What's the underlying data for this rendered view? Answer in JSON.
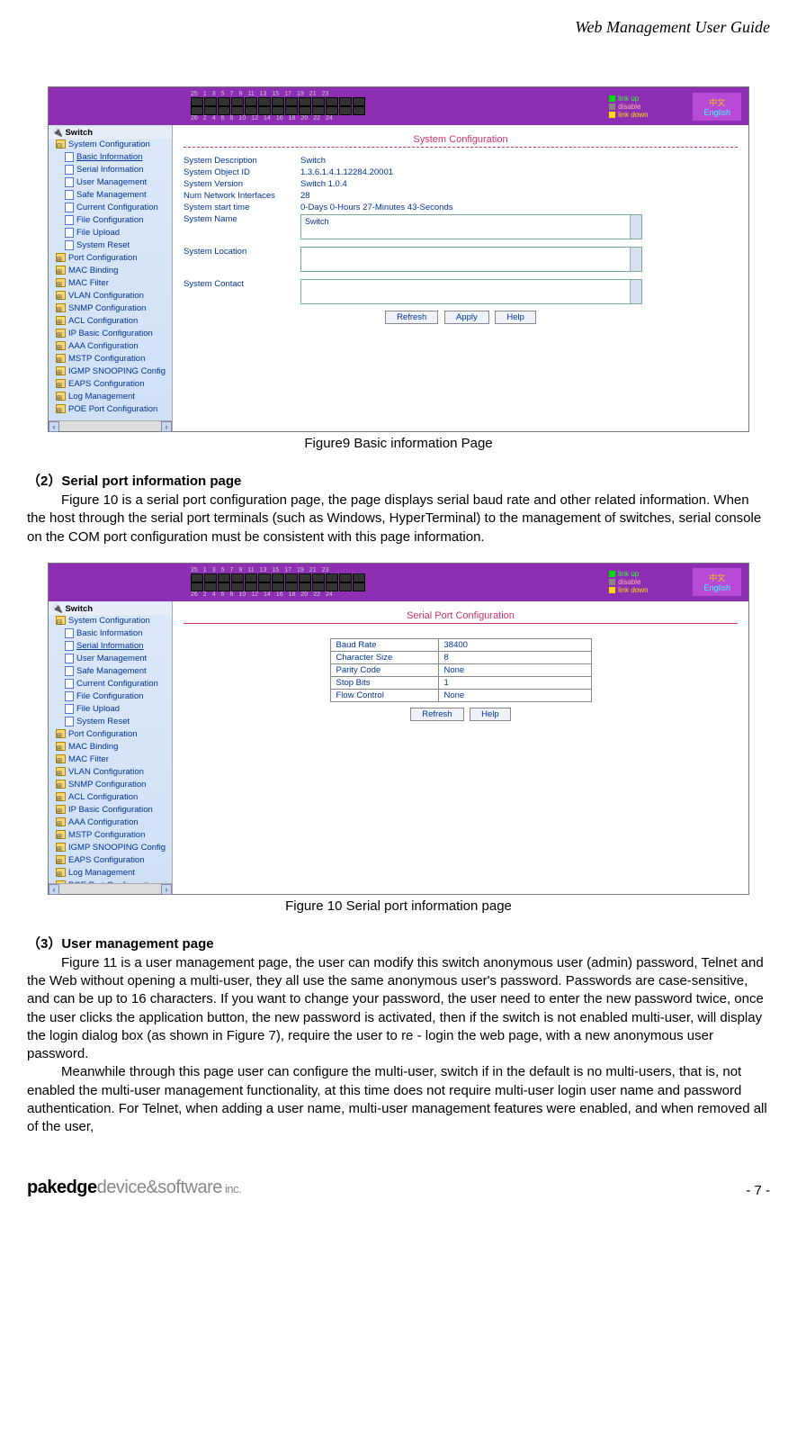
{
  "doc_header": "Web Management User Guide",
  "figure9": {
    "caption": "Figure9 Basic information Page",
    "legend": {
      "up": "link up",
      "disable": "disable",
      "down": "link down"
    },
    "lang": {
      "cn": "中文",
      "en": "English"
    },
    "side_title": "Switch",
    "sidebar_sys": "System Configuration",
    "sidebar_items": [
      "Basic Information",
      "Serial Information",
      "User Management",
      "Safe Management",
      "Current Configuration",
      "File Configuration",
      "File Upload",
      "System Reset"
    ],
    "sidebar_folders": [
      "Port Configuration",
      "MAC Binding",
      "MAC Filter",
      "VLAN Configuration",
      "SNMP Configuration",
      "ACL Configuration",
      "IP Basic Configuration",
      "AAA Configuration",
      "MSTP Configuration",
      "IGMP SNOOPING Config",
      "EAPS Configuration",
      "Log Management",
      "POE Port Configuration"
    ],
    "main_title": "System Configuration",
    "rows": {
      "desc_l": "System Description",
      "desc_v": "Switch",
      "oid_l": "System Object ID",
      "oid_v": "1.3.6.1.4.1.12284.20001",
      "ver_l": "System Version",
      "ver_v": "Switch 1.0.4",
      "num_l": "Num Network Interfaces",
      "num_v": "28",
      "start_l": "System start time",
      "start_v": "0-Days 0-Hours 27-Minutes 43-Seconds",
      "name_l": "System Name",
      "name_v": "Switch",
      "loc_l": "System Location",
      "con_l": "System Contact"
    },
    "buttons": {
      "refresh": "Refresh",
      "apply": "Apply",
      "help": "Help"
    }
  },
  "section2": {
    "heading": "（2）Serial port information page",
    "body": "Figure 10 is a serial port configuration page, the page displays serial baud rate and other related information. When the host through the serial port terminals (such as Windows, HyperTerminal) to the management of switches, serial console on the COM port configuration must be consistent with this page information."
  },
  "figure10": {
    "caption": "Figure 10 Serial port information page",
    "main_title": "Serial Port Configuration",
    "table": {
      "baud_l": "Baud Rate",
      "baud_v": "38400",
      "char_l": "Character Size",
      "char_v": "8",
      "par_l": "Parity Code",
      "par_v": "None",
      "stop_l": "Stop Bits",
      "stop_v": "1",
      "flow_l": "Flow Control",
      "flow_v": "None"
    },
    "buttons": {
      "refresh": "Refresh",
      "help": "Help"
    }
  },
  "section3": {
    "heading": "（3）User management page",
    "body1": "Figure 11 is a user management page, the user can modify this switch anonymous user (admin) password, Telnet and the Web without opening a multi-user, they all use the same anonymous user's password. Passwords are case-sensitive, and can be up to 16 characters. If you want to change your password, the user need to enter the new password twice, once the user clicks the application button, the new password is activated, then if the switch is not enabled multi-user, will display the login dialog box (as shown in Figure 7), require the user to re - login the web page, with a new anonymous user password.",
    "body2": "Meanwhile through this page user can configure the multi-user, switch if in the default is no multi-users, that is, not enabled the multi-user management functionality, at this time does not require multi-user login user name and password authentication. For Telnet, when adding a user name, multi-user management features were enabled, and when removed all of the user,"
  },
  "footer": {
    "logo1": "pakedge",
    "logo2": "device&software",
    "logo3": " inc.",
    "page": "- 7 -"
  }
}
